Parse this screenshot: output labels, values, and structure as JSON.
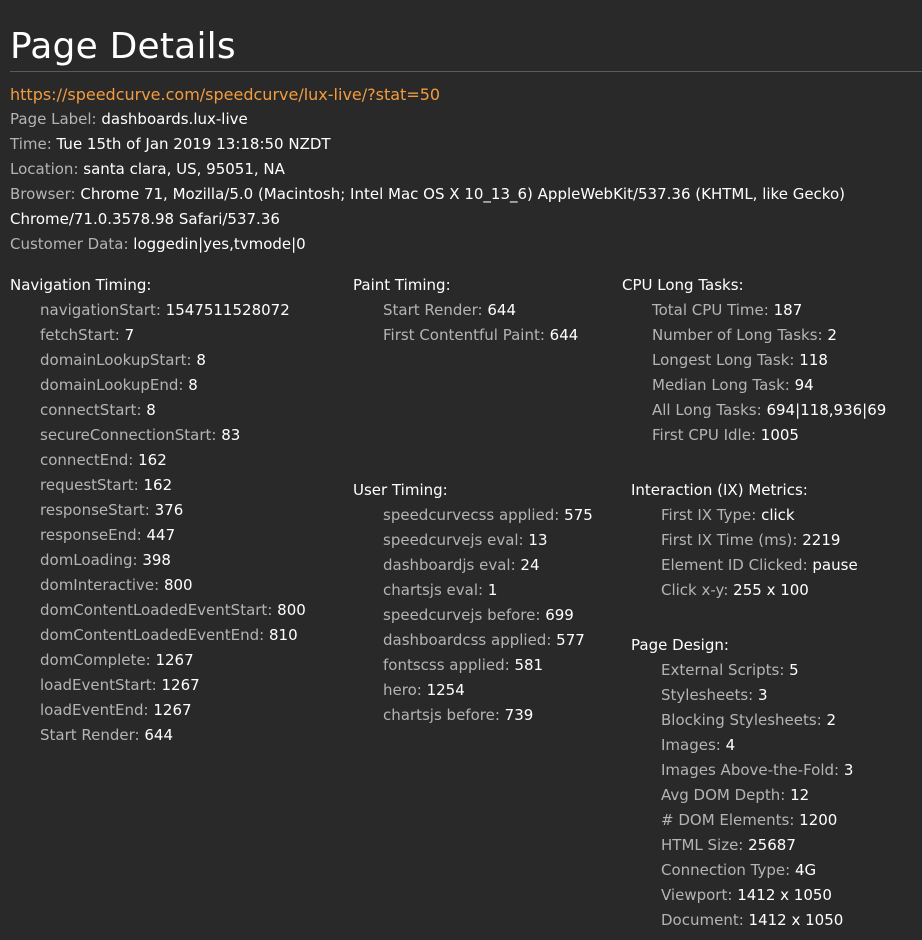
{
  "page_title": "Page Details",
  "url": "https://speedcurve.com/speedcurve/lux-live/?stat=50",
  "info": [
    {
      "label": "Page Label:",
      "value": "dashboards.lux-live"
    },
    {
      "label": "Time:",
      "value": "Tue 15th of Jan 2019 13:18:50 NZDT"
    },
    {
      "label": "Location:",
      "value": "santa clara, US, 95051, NA"
    },
    {
      "label": "Browser:",
      "value": "Chrome 71, Mozilla/5.0 (Macintosh; Intel Mac OS X 10_13_6) AppleWebKit/537.36 (KHTML, like Gecko) Chrome/71.0.3578.98 Safari/537.36"
    },
    {
      "label": "Customer Data:",
      "value": "loggedin|yes,tvmode|0"
    }
  ],
  "sections": {
    "navigation": {
      "title": "Navigation Timing:",
      "items": [
        {
          "label": "navigationStart:",
          "value": "1547511528072"
        },
        {
          "label": "fetchStart:",
          "value": "7"
        },
        {
          "label": "domainLookupStart:",
          "value": "8"
        },
        {
          "label": "domainLookupEnd:",
          "value": "8"
        },
        {
          "label": "connectStart:",
          "value": "8"
        },
        {
          "label": "secureConnectionStart:",
          "value": "83"
        },
        {
          "label": "connectEnd:",
          "value": "162"
        },
        {
          "label": "requestStart:",
          "value": "162"
        },
        {
          "label": "responseStart:",
          "value": "376"
        },
        {
          "label": "responseEnd:",
          "value": "447"
        },
        {
          "label": "domLoading:",
          "value": "398"
        },
        {
          "label": "domInteractive:",
          "value": "800"
        },
        {
          "label": "domContentLoadedEventStart:",
          "value": "800"
        },
        {
          "label": "domContentLoadedEventEnd:",
          "value": "810"
        },
        {
          "label": "domComplete:",
          "value": "1267"
        },
        {
          "label": "loadEventStart:",
          "value": "1267"
        },
        {
          "label": "loadEventEnd:",
          "value": "1267"
        },
        {
          "label": "Start Render:",
          "value": "644"
        }
      ]
    },
    "paint": {
      "title": "Paint Timing:",
      "items": [
        {
          "label": "Start Render:",
          "value": "644"
        },
        {
          "label": "First Contentful Paint:",
          "value": "644"
        }
      ]
    },
    "cpu": {
      "title": "CPU Long Tasks:",
      "items": [
        {
          "label": "Total CPU Time:",
          "value": "187"
        },
        {
          "label": "Number of Long Tasks:",
          "value": "2"
        },
        {
          "label": "Longest Long Task:",
          "value": "118"
        },
        {
          "label": "Median Long Task:",
          "value": "94"
        },
        {
          "label": "All Long Tasks:",
          "value": "694|118,936|69"
        },
        {
          "label": "First CPU Idle:",
          "value": "1005"
        }
      ]
    },
    "user": {
      "title": "User Timing:",
      "items": [
        {
          "label": "speedcurvecss applied:",
          "value": "575"
        },
        {
          "label": "speedcurvejs eval:",
          "value": "13"
        },
        {
          "label": "dashboardjs eval:",
          "value": "24"
        },
        {
          "label": "chartsjs eval:",
          "value": "1"
        },
        {
          "label": "speedcurvejs before:",
          "value": "699"
        },
        {
          "label": "dashboardcss applied:",
          "value": "577"
        },
        {
          "label": "fontscss applied:",
          "value": "581"
        },
        {
          "label": "hero:",
          "value": "1254"
        },
        {
          "label": "chartsjs before:",
          "value": "739"
        }
      ]
    },
    "ix": {
      "title": "Interaction (IX) Metrics:",
      "items": [
        {
          "label": "First IX Type:",
          "value": "click"
        },
        {
          "label": "First IX Time (ms):",
          "value": "2219"
        },
        {
          "label": "Element ID Clicked:",
          "value": "pause"
        },
        {
          "label": "Click x-y:",
          "value": "255 x 100"
        }
      ]
    },
    "design": {
      "title": "Page Design:",
      "items": [
        {
          "label": "External Scripts:",
          "value": "5"
        },
        {
          "label": "Stylesheets:",
          "value": "3"
        },
        {
          "label": "Blocking Stylesheets:",
          "value": "2"
        },
        {
          "label": "Images:",
          "value": "4"
        },
        {
          "label": "Images Above-the-Fold:",
          "value": "3"
        },
        {
          "label": "Avg DOM Depth:",
          "value": "12"
        },
        {
          "label": "# DOM Elements:",
          "value": "1200"
        },
        {
          "label": "HTML Size:",
          "value": "25687"
        },
        {
          "label": "Connection Type:",
          "value": "4G"
        },
        {
          "label": "Viewport:",
          "value": "1412 x 1050"
        },
        {
          "label": "Document:",
          "value": "1412 x 1050"
        }
      ]
    }
  }
}
